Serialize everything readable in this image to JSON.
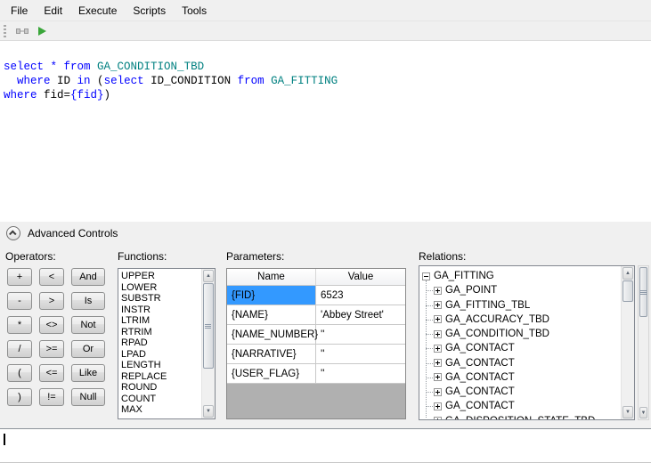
{
  "colors": {
    "keyword": "#0000ff",
    "table_name": "#008080",
    "selection": "#3399ff",
    "run_green": "#3aa63a"
  },
  "icons": {
    "scroll_up": "▲",
    "scroll_down": "▼"
  },
  "menu_bar": {
    "items": [
      "File",
      "Edit",
      "Execute",
      "Scripts",
      "Tools"
    ]
  },
  "sql_editor": {
    "lines": [
      {
        "tokens": [
          {
            "t": "select * from",
            "c": "kw"
          },
          {
            "t": " ",
            "c": "pl"
          },
          {
            "t": "GA_CONDITION_TBD",
            "c": "tbl"
          }
        ]
      },
      {
        "tokens": [
          {
            "t": "  where",
            "c": "kw"
          },
          {
            "t": " ID ",
            "c": "pl"
          },
          {
            "t": "in",
            "c": "kw"
          },
          {
            "t": " (",
            "c": "pl"
          },
          {
            "t": "select",
            "c": "kw"
          },
          {
            "t": " ID_CONDITION ",
            "c": "pl"
          },
          {
            "t": "from",
            "c": "kw"
          },
          {
            "t": " ",
            "c": "pl"
          },
          {
            "t": "GA_FITTING",
            "c": "tbl"
          }
        ]
      },
      {
        "tokens": [
          {
            "t": "where",
            "c": "kw"
          },
          {
            "t": " fid=",
            "c": "pl"
          },
          {
            "t": "{fid}",
            "c": "kw"
          },
          {
            "t": ")",
            "c": "pl"
          }
        ]
      }
    ]
  },
  "advanced": {
    "label": "Advanced Controls"
  },
  "operators": {
    "label": "Operators:",
    "rows": [
      [
        "+",
        "<",
        "And"
      ],
      [
        "-",
        ">",
        "Is"
      ],
      [
        "*",
        "<>",
        "Not"
      ],
      [
        "/",
        ">=",
        "Or"
      ],
      [
        "(",
        "<=",
        "Like"
      ],
      [
        ")",
        "!=",
        "Null"
      ]
    ]
  },
  "functions": {
    "label": "Functions:",
    "items": [
      "UPPER",
      "LOWER",
      "SUBSTR",
      "INSTR",
      "LTRIM",
      "RTRIM",
      "RPAD",
      "LPAD",
      "LENGTH",
      "REPLACE",
      "ROUND",
      "COUNT",
      "MAX"
    ]
  },
  "parameters": {
    "label": "Parameters:",
    "columns": [
      "Name",
      "Value"
    ],
    "rows": [
      {
        "name": "{FID}",
        "value": "6523",
        "selected": true
      },
      {
        "name": "{NAME}",
        "value": "'Abbey Street'",
        "selected": false
      },
      {
        "name": "{NAME_NUMBER}",
        "value": "''",
        "selected": false
      },
      {
        "name": "{NARRATIVE}",
        "value": "''",
        "selected": false
      },
      {
        "name": "{USER_FLAG}",
        "value": "''",
        "selected": false
      }
    ]
  },
  "relations": {
    "label": "Relations:",
    "root": "GA_FITTING",
    "children": [
      "GA_POINT",
      "GA_FITTING_TBL",
      "GA_ACCURACY_TBD",
      "GA_CONDITION_TBD",
      "GA_CONTACT",
      "GA_CONTACT",
      "GA_CONTACT",
      "GA_CONTACT",
      "GA_CONTACT",
      "GA_DISPOSITION_STATE_TBD"
    ]
  }
}
